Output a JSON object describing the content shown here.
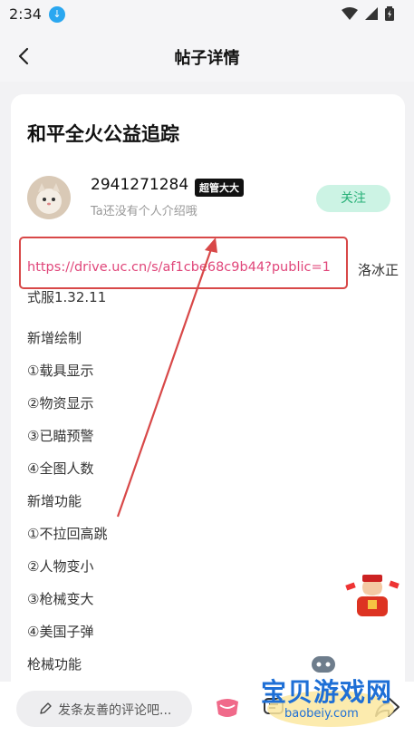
{
  "status_bar": {
    "time": "2:34"
  },
  "header": {
    "title": "帖子详情"
  },
  "post": {
    "title": "和平全火公益追踪",
    "author": {
      "username": "2941271284",
      "badge": "超管大大",
      "bio": "Ta还没有个人介绍哦"
    },
    "follow_label": "关注",
    "link_text": "https://drive.uc.cn/s/af1cbe68c9b44?public=1",
    "link_suffix": "洛冰正",
    "link_line2": "式服1.32.11",
    "content_lines": [
      "新增绘制",
      "①载具显示",
      "②物资显示",
      "③已瞄预警",
      "④全图人数",
      "新增功能",
      "①不拉回高跳",
      "②人物变小",
      "③枪械变大",
      "④美国子弹",
      "枪械功能"
    ]
  },
  "bottom_bar": {
    "comment_placeholder": "发条友善的评论吧..."
  },
  "watermark": {
    "text": "宝贝游戏网",
    "sub": "baobeiy.com"
  },
  "colors": {
    "link": "#e0467a",
    "follow_bg": "#ccf3e4",
    "follow_text": "#27b077",
    "highlight": "#d84848"
  }
}
